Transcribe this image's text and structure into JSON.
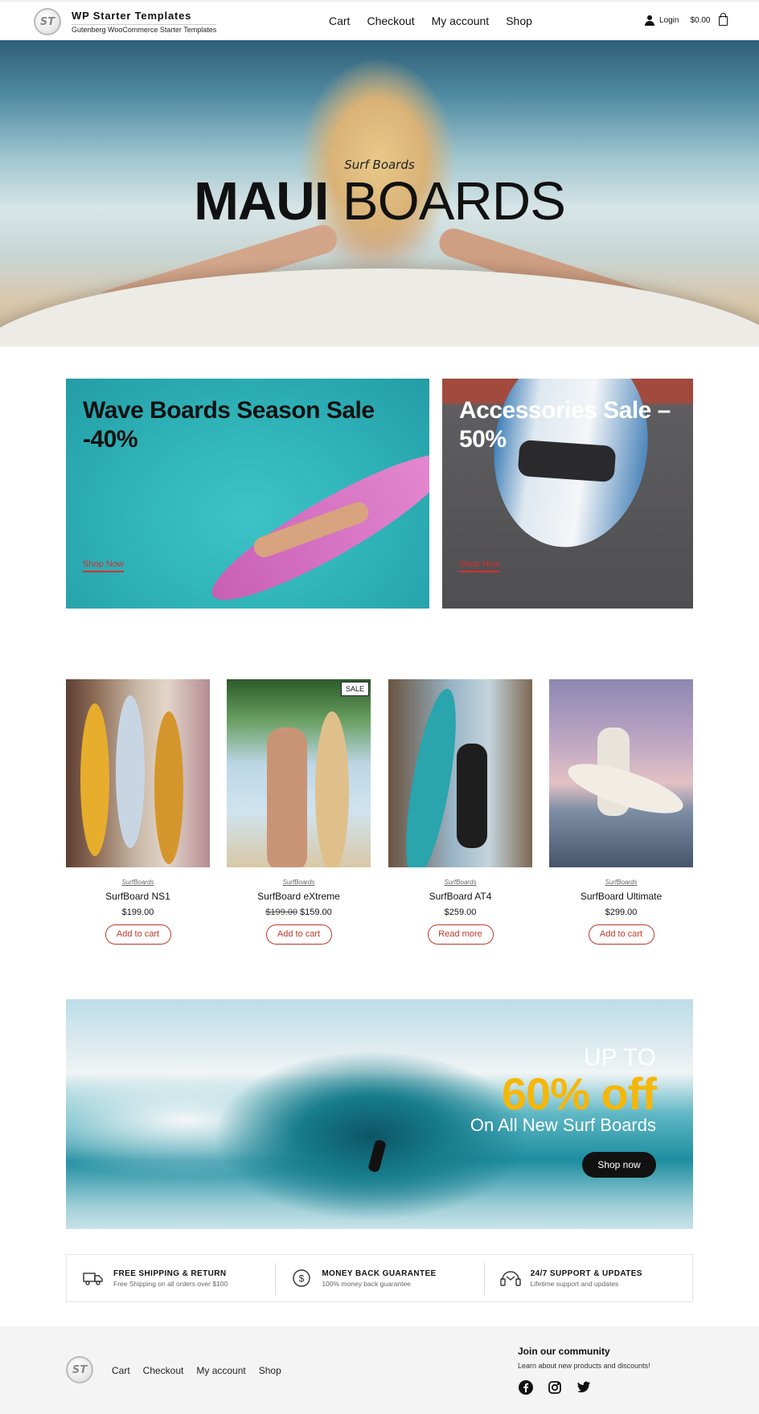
{
  "header": {
    "logo_text": "ST",
    "site_title": "WP Starter Templates",
    "site_tagline": "Gutenberg WooCommerce Starter Templates",
    "nav": [
      "Cart",
      "Checkout",
      "My account",
      "Shop"
    ],
    "login_label": "Login",
    "cart_total": "$0.00"
  },
  "hero": {
    "subtitle": "Surf Boards",
    "title_bold": "MAUI",
    "title_light": " BOARDS"
  },
  "promos": [
    {
      "title": "Wave Boards Season Sale -40%",
      "link": "Shop Now"
    },
    {
      "title": "Accessories Sale – 50%",
      "link": "Shop Now"
    }
  ],
  "products": [
    {
      "category": "SurfBoards",
      "name": "SurfBoard NS1",
      "price": "$199.00",
      "old_price": "",
      "button": "Add to cart",
      "sale": false
    },
    {
      "category": "SurfBoards",
      "name": "SurfBoard eXtreme",
      "price": "$159.00",
      "old_price": "$199.00",
      "button": "Add to cart",
      "sale": true,
      "badge": "SALE"
    },
    {
      "category": "SurfBoards",
      "name": "SurfBoard AT4",
      "price": "$259.00",
      "old_price": "",
      "button": "Read more",
      "sale": false
    },
    {
      "category": "SurfBoards",
      "name": "SurfBoard Ultimate",
      "price": "$299.00",
      "old_price": "",
      "button": "Add to cart",
      "sale": false
    }
  ],
  "banner": {
    "line1": "UP TO",
    "highlight": "60% off",
    "line3": "On All New Surf Boards",
    "button": "Shop now",
    "highlight_color": "#f5b70a"
  },
  "features": [
    {
      "icon": "truck-icon",
      "title": "FREE SHIPPING & RETURN",
      "desc": "Free Shipping on all orders over $100"
    },
    {
      "icon": "dollar-icon",
      "title": "MONEY BACK GUARANTEE",
      "desc": "100% money back guarantee"
    },
    {
      "icon": "support-icon",
      "title": "24/7 SUPPORT & UPDATES",
      "desc": "Lifetime support and updates"
    }
  ],
  "footer": {
    "logo_text": "ST",
    "nav": [
      "Cart",
      "Checkout",
      "My account",
      "Shop"
    ],
    "community_title": "Join our community",
    "community_sub": "Learn about new products and discounts!",
    "socials": [
      "facebook-icon",
      "instagram-icon",
      "twitter-icon"
    ]
  },
  "colors": {
    "accent_red": "#c0392b",
    "text_dark": "#111111",
    "footer_bg": "#f4f4f5"
  }
}
